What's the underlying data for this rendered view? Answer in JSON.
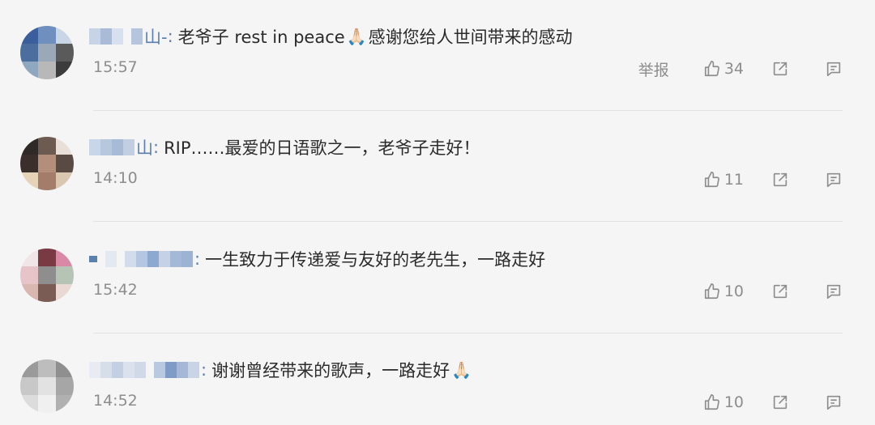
{
  "comments": [
    {
      "name_visible": "山-",
      "text": "老爷子 rest in peace",
      "emoji": "🙏🏻",
      "text_after": "感谢您给人世间带来的感动",
      "time": "15:57",
      "report_label": "举报",
      "likes": "34"
    },
    {
      "name_visible": "山",
      "text": "RIP……最爱的日语歌之一，老爷子走好！",
      "emoji": "",
      "text_after": "",
      "time": "14:10",
      "report_label": "",
      "likes": "11"
    },
    {
      "name_visible": "",
      "text": "一生致力于传递爱与友好的老先生，一路走好",
      "emoji": "",
      "text_after": "",
      "time": "15:42",
      "report_label": "",
      "likes": "10"
    },
    {
      "name_visible": "",
      "text": "谢谢曾经带来的歌声，一路走好",
      "emoji": "🙏🏻",
      "text_after": "",
      "time": "14:52",
      "report_label": "",
      "likes": "10"
    }
  ],
  "colors": {
    "background": "#f5f5f5",
    "username": "#5b7fb0",
    "text": "#2b2b2b",
    "meta": "#8d8d8d",
    "divider": "#e2e2e2"
  },
  "icons": {
    "like": "thumbs-up-icon",
    "share": "share-icon",
    "reply": "comment-icon"
  }
}
